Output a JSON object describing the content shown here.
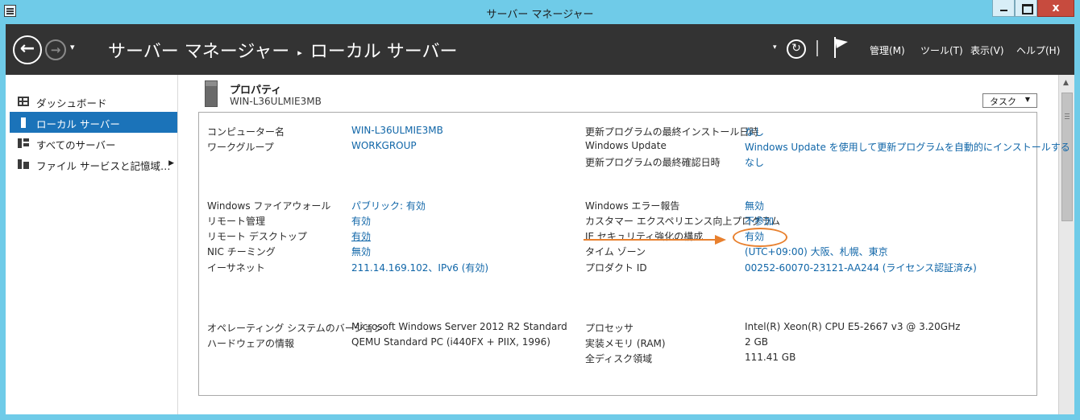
{
  "window": {
    "title": "サーバー マネージャー",
    "close_glyph": "x"
  },
  "header": {
    "back_glyph": "←",
    "forward_glyph": "→",
    "dropdown_glyph": "▾",
    "breadcrumb": {
      "root": "サーバー マネージャー",
      "separator": "▸",
      "current": "ローカル サーバー"
    },
    "refresh_glyph": "↻",
    "menus": [
      "管理(M)",
      "ツール(T)",
      "表示(V)",
      "ヘルプ(H)"
    ]
  },
  "sidebar": {
    "items": [
      {
        "label": "ダッシュボード",
        "icon": "dashboard-icon",
        "active": false
      },
      {
        "label": "ローカル サーバー",
        "icon": "server-icon",
        "active": true
      },
      {
        "label": "すべてのサーバー",
        "icon": "servers-icon",
        "active": false
      },
      {
        "label": "ファイル サービスと記憶域…",
        "icon": "file-services-icon",
        "active": false,
        "expand_glyph": "▶"
      }
    ]
  },
  "properties": {
    "title": "プロパティ",
    "server_name": "WIN-L36ULMIE3MB",
    "tasks_label": "タスク",
    "tasks_glyph": "▼",
    "left_col": [
      {
        "label": "コンピューター名",
        "value": "WIN-L36ULMIE3MB",
        "link": true
      },
      {
        "label": "ワークグループ",
        "value": "WORKGROUP",
        "link": true
      },
      {
        "label": "Windows ファイアウォール",
        "value": "パブリック: 有効",
        "link": true
      },
      {
        "label": "リモート管理",
        "value": "有効",
        "link": true
      },
      {
        "label": "リモート デスクトップ",
        "value": "有効",
        "link": true
      },
      {
        "label": "NIC チーミング",
        "value": "無効",
        "link": true
      },
      {
        "label": "イーサネット",
        "value": "211.14.169.102、IPv6 (有効)",
        "link": true
      },
      {
        "label": "オペレーティング システムのバージョン",
        "value": "Microsoft Windows Server 2012 R2 Standard",
        "link": false
      },
      {
        "label": "ハードウェアの情報",
        "value": "QEMU Standard PC (i440FX + PIIX, 1996)",
        "link": false
      }
    ],
    "right_col": [
      {
        "label": "更新プログラムの最終インストール日時",
        "value": "なし",
        "link": true
      },
      {
        "label": "Windows Update",
        "value": "Windows Update を使用して更新プログラムを自動的にインストールする",
        "link": true
      },
      {
        "label": "更新プログラムの最終確認日時",
        "value": "なし",
        "link": true
      },
      {
        "label": "Windows エラー報告",
        "value": "無効",
        "link": true
      },
      {
        "label": "カスタマー エクスペリエンス向上プログラム",
        "value": "不参加",
        "link": true
      },
      {
        "label": "IE セキュリティ強化の構成",
        "value": "有効",
        "link": true
      },
      {
        "label": "タイム ゾーン",
        "value": "(UTC+09:00) 大阪、札幌、東京",
        "link": true
      },
      {
        "label": "プロダクト ID",
        "value": "00252-60070-23121-AA244 (ライセンス認証済み)",
        "link": true
      },
      {
        "label": "プロセッサ",
        "value": "Intel(R) Xeon(R) CPU E5-2667 v3 @ 3.20GHz",
        "link": false
      },
      {
        "label": "実装メモリ (RAM)",
        "value": "2 GB",
        "link": false
      },
      {
        "label": "全ディスク領域",
        "value": "111.41 GB",
        "link": false
      }
    ]
  },
  "annotation": {
    "color": "#e8802e"
  },
  "colors": {
    "titlebar": "#6fcbe8",
    "header": "#333333",
    "accent": "#1b73b9",
    "link": "#1066a8"
  }
}
